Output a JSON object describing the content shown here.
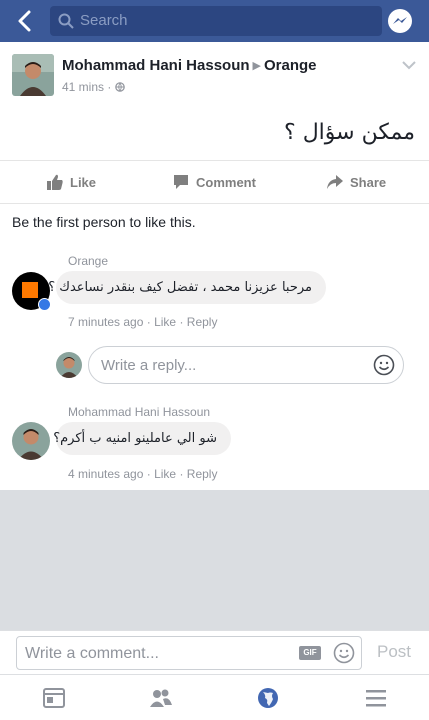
{
  "topbar": {
    "search_placeholder": "Search",
    "icons": [
      "back-arrow-icon",
      "search-icon",
      "messenger-icon"
    ],
    "color": "#3b5998"
  },
  "post": {
    "author": "Mohammad Hani Hassoun",
    "target": "Orange",
    "time": "41 mins",
    "privacy_icon": "globe-icon",
    "text": "ممكن سؤال ؟"
  },
  "actions": {
    "like": "Like",
    "comment": "Comment",
    "share": "Share"
  },
  "likes_text": "Be the first person to like this.",
  "comments": [
    {
      "name": "Orange",
      "text": "مرحبا عزيزنا محمد ، تفضل كيف بنقدر نساعدك ؟",
      "time": "7 minutes ago",
      "like": "Like",
      "reply": "Reply",
      "sep": "·"
    },
    {
      "name": "Mohammad Hani Hassoun",
      "text": "شو الي عاملينو امنيه ب أكرم؟",
      "time": "4 minutes ago",
      "like": "Like",
      "reply": "Reply",
      "sep": "·"
    }
  ],
  "reply_placeholder": "Write a reply...",
  "composer": {
    "placeholder": "Write a comment...",
    "gif_label": "GIF",
    "post_label": "Post"
  },
  "tabbar": {
    "tabs": [
      "news-feed-icon",
      "friends-icon",
      "globe-notifications-icon",
      "menu-icon"
    ],
    "active": "globe-notifications-icon"
  }
}
